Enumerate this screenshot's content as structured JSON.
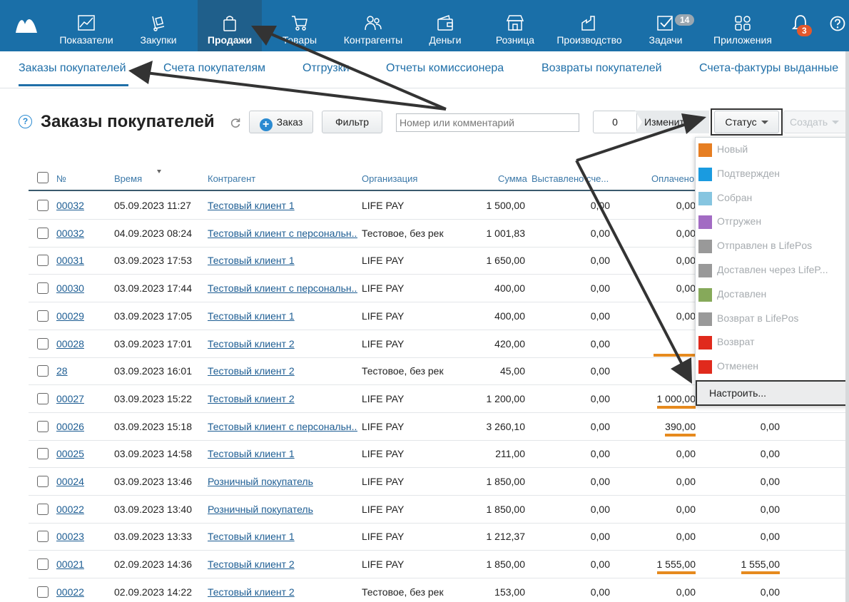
{
  "nav": {
    "items": [
      {
        "label": "Показатели",
        "icon": "chart-line-icon"
      },
      {
        "label": "Закупки",
        "icon": "cart-dolly-icon"
      },
      {
        "label": "Продажи",
        "icon": "shopping-bag-icon"
      },
      {
        "label": "Товары",
        "icon": "cart-icon"
      },
      {
        "label": "Контрагенты",
        "icon": "people-icon"
      },
      {
        "label": "Деньги",
        "icon": "wallet-icon"
      },
      {
        "label": "Розница",
        "icon": "store-icon"
      },
      {
        "label": "Производство",
        "icon": "factory-icon"
      },
      {
        "label": "Задачи",
        "icon": "checkbox-icon"
      },
      {
        "label": "Приложения",
        "icon": "apps-icon"
      }
    ],
    "active": "Продажи",
    "tasks_badge": "14",
    "notifications_badge": "3",
    "help_icon": "question-icon",
    "bell_icon": "bell-icon",
    "brand_color": "#1a6fa8"
  },
  "subtabs": [
    "Заказы покупателей",
    "Счета покупателям",
    "Отгрузки",
    "Отчеты комиссионера",
    "Возвраты покупателей",
    "Счета-фактуры выданные"
  ],
  "toolbar": {
    "help": "?",
    "title": "Заказы покупателей",
    "order_button": "Заказ",
    "filter_button": "Фильтр",
    "search_placeholder": "Номер или комментарий",
    "selected_count": "0",
    "change_label": "Изменить",
    "status_label": "Статус",
    "create_label": "Создать"
  },
  "table": {
    "headers": [
      "№",
      "Время",
      "Контрагент",
      "Организация",
      "Сумма",
      "Выставлено сче...",
      "Оплачено"
    ],
    "rows": [
      {
        "num": "00032",
        "time": "05.09.2023 11:27",
        "counterparty": "Тестовый клиент 1",
        "org": "LIFE PAY",
        "sum": "1 500,00",
        "invoiced": "0,00",
        "paid": "0,00",
        "extra": ""
      },
      {
        "num": "00032",
        "time": "04.09.2023 08:24",
        "counterparty": "Тестовый клиент с персональн...",
        "org": "Тестовое, без рек",
        "sum": "1 001,83",
        "invoiced": "0,00",
        "paid": "0,00",
        "extra": ""
      },
      {
        "num": "00031",
        "time": "03.09.2023 17:53",
        "counterparty": "Тестовый клиент 1",
        "org": "LIFE PAY",
        "sum": "1 650,00",
        "invoiced": "0,00",
        "paid": "0,00",
        "extra": ""
      },
      {
        "num": "00030",
        "time": "03.09.2023 17:44",
        "counterparty": "Тестовый клиент с персональн...",
        "org": "LIFE PAY",
        "sum": "400,00",
        "invoiced": "0,00",
        "paid": "0,00",
        "extra": ""
      },
      {
        "num": "00029",
        "time": "03.09.2023 17:05",
        "counterparty": "Тестовый клиент 1",
        "org": "LIFE PAY",
        "sum": "400,00",
        "invoiced": "0,00",
        "paid": "0,00",
        "extra": ""
      },
      {
        "num": "00028",
        "time": "03.09.2023 17:01",
        "counterparty": "Тестовый клиент 2",
        "org": "LIFE PAY",
        "sum": "420,00",
        "invoiced": "0,00",
        "paid": "",
        "extra": ""
      },
      {
        "num": "28",
        "time": "03.09.2023 16:01",
        "counterparty": "Тестовый клиент 2",
        "org": "Тестовое, без рек",
        "sum": "45,00",
        "invoiced": "0,00",
        "paid": "",
        "extra": ""
      },
      {
        "num": "00027",
        "time": "03.09.2023 15:22",
        "counterparty": "Тестовый клиент 2",
        "org": "LIFE PAY",
        "sum": "1 200,00",
        "invoiced": "0,00",
        "paid": "1 000,00",
        "extra": ""
      },
      {
        "num": "00026",
        "time": "03.09.2023 15:18",
        "counterparty": "Тестовый клиент с персональн...",
        "org": "LIFE PAY",
        "sum": "3 260,10",
        "invoiced": "0,00",
        "paid": "390,00",
        "extra": "0,00"
      },
      {
        "num": "00025",
        "time": "03.09.2023 14:58",
        "counterparty": "Тестовый клиент 1",
        "org": "LIFE PAY",
        "sum": "211,00",
        "invoiced": "0,00",
        "paid": "0,00",
        "extra": "0,00"
      },
      {
        "num": "00024",
        "time": "03.09.2023 13:46",
        "counterparty": "Розничный покупатель",
        "org": "LIFE PAY",
        "sum": "1 850,00",
        "invoiced": "0,00",
        "paid": "0,00",
        "extra": "0,00"
      },
      {
        "num": "00022",
        "time": "03.09.2023 13:40",
        "counterparty": "Розничный покупатель",
        "org": "LIFE PAY",
        "sum": "1 850,00",
        "invoiced": "0,00",
        "paid": "0,00",
        "extra": "0,00"
      },
      {
        "num": "00023",
        "time": "03.09.2023 13:33",
        "counterparty": "Тестовый клиент 1",
        "org": "LIFE PAY",
        "sum": "1 212,37",
        "invoiced": "0,00",
        "paid": "0,00",
        "extra": "0,00"
      },
      {
        "num": "00021",
        "time": "02.09.2023 14:36",
        "counterparty": "Тестовый клиент 2",
        "org": "LIFE PAY",
        "sum": "1 850,00",
        "invoiced": "0,00",
        "paid": "1 555,00",
        "extra": "1 555,00"
      },
      {
        "num": "00022",
        "time": "02.09.2023 14:22",
        "counterparty": "Тестовый клиент 2",
        "org": "Тестовое, без рек",
        "sum": "153,00",
        "invoiced": "0,00",
        "paid": "0,00",
        "extra": "0,00"
      }
    ],
    "highlight_color": "#e68a1e"
  },
  "status_dropdown": {
    "items": [
      {
        "label": "Новый",
        "color": "#e67e22"
      },
      {
        "label": "Подтвержден",
        "color": "#1a9be0"
      },
      {
        "label": "Собран",
        "color": "#86c5e0"
      },
      {
        "label": "Отгружен",
        "color": "#a26bc3"
      },
      {
        "label": "Отправлен в LifePos",
        "color": "#999999"
      },
      {
        "label": "Доставлен через LifeP...",
        "color": "#999999"
      },
      {
        "label": "Доставлен",
        "color": "#86a95a"
      },
      {
        "label": "Возврат в LifePos",
        "color": "#999999"
      },
      {
        "label": "Возврат",
        "color": "#e02a1c"
      },
      {
        "label": "Отменен",
        "color": "#e02a1c"
      }
    ],
    "configure": "Настроить..."
  }
}
